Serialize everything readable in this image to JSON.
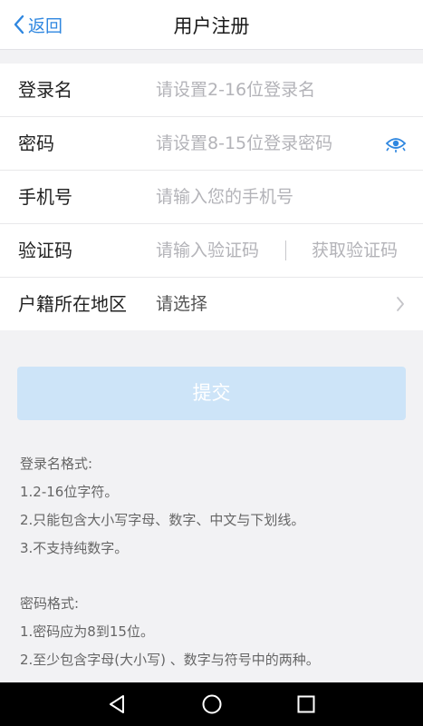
{
  "header": {
    "back_label": "返回",
    "title": "用户注册"
  },
  "form": {
    "login_name": {
      "label": "登录名",
      "placeholder": "请设置2-16位登录名"
    },
    "password": {
      "label": "密码",
      "placeholder": "请设置8-15位登录密码",
      "icon": "eye-icon"
    },
    "phone": {
      "label": "手机号",
      "placeholder": "请输入您的手机号"
    },
    "code": {
      "label": "验证码",
      "placeholder": "请输入验证码",
      "get_code": "获取验证码"
    },
    "region": {
      "label": "户籍所在地区",
      "value": "请选择",
      "icon": "chevron-right-icon"
    }
  },
  "submit_label": "提交",
  "notes": {
    "login_title": "登录名格式:",
    "login_1": "1.2-16位字符。",
    "login_2": "2.只能包含大小写字母、数字、中文与下划线。",
    "login_3": "3.不支持纯数字。",
    "pwd_title": "密码格式:",
    "pwd_1": "1.密码应为8到15位。",
    "pwd_2": "2.至少包含字母(大小写) 、数字与符号中的两种。"
  },
  "colors": {
    "accent": "#2f87e0",
    "submit_disabled": "#cde4f8",
    "background": "#f2f2f4"
  },
  "navbar": {
    "icons": [
      "back-triangle-icon",
      "home-circle-icon",
      "recents-square-icon"
    ]
  }
}
